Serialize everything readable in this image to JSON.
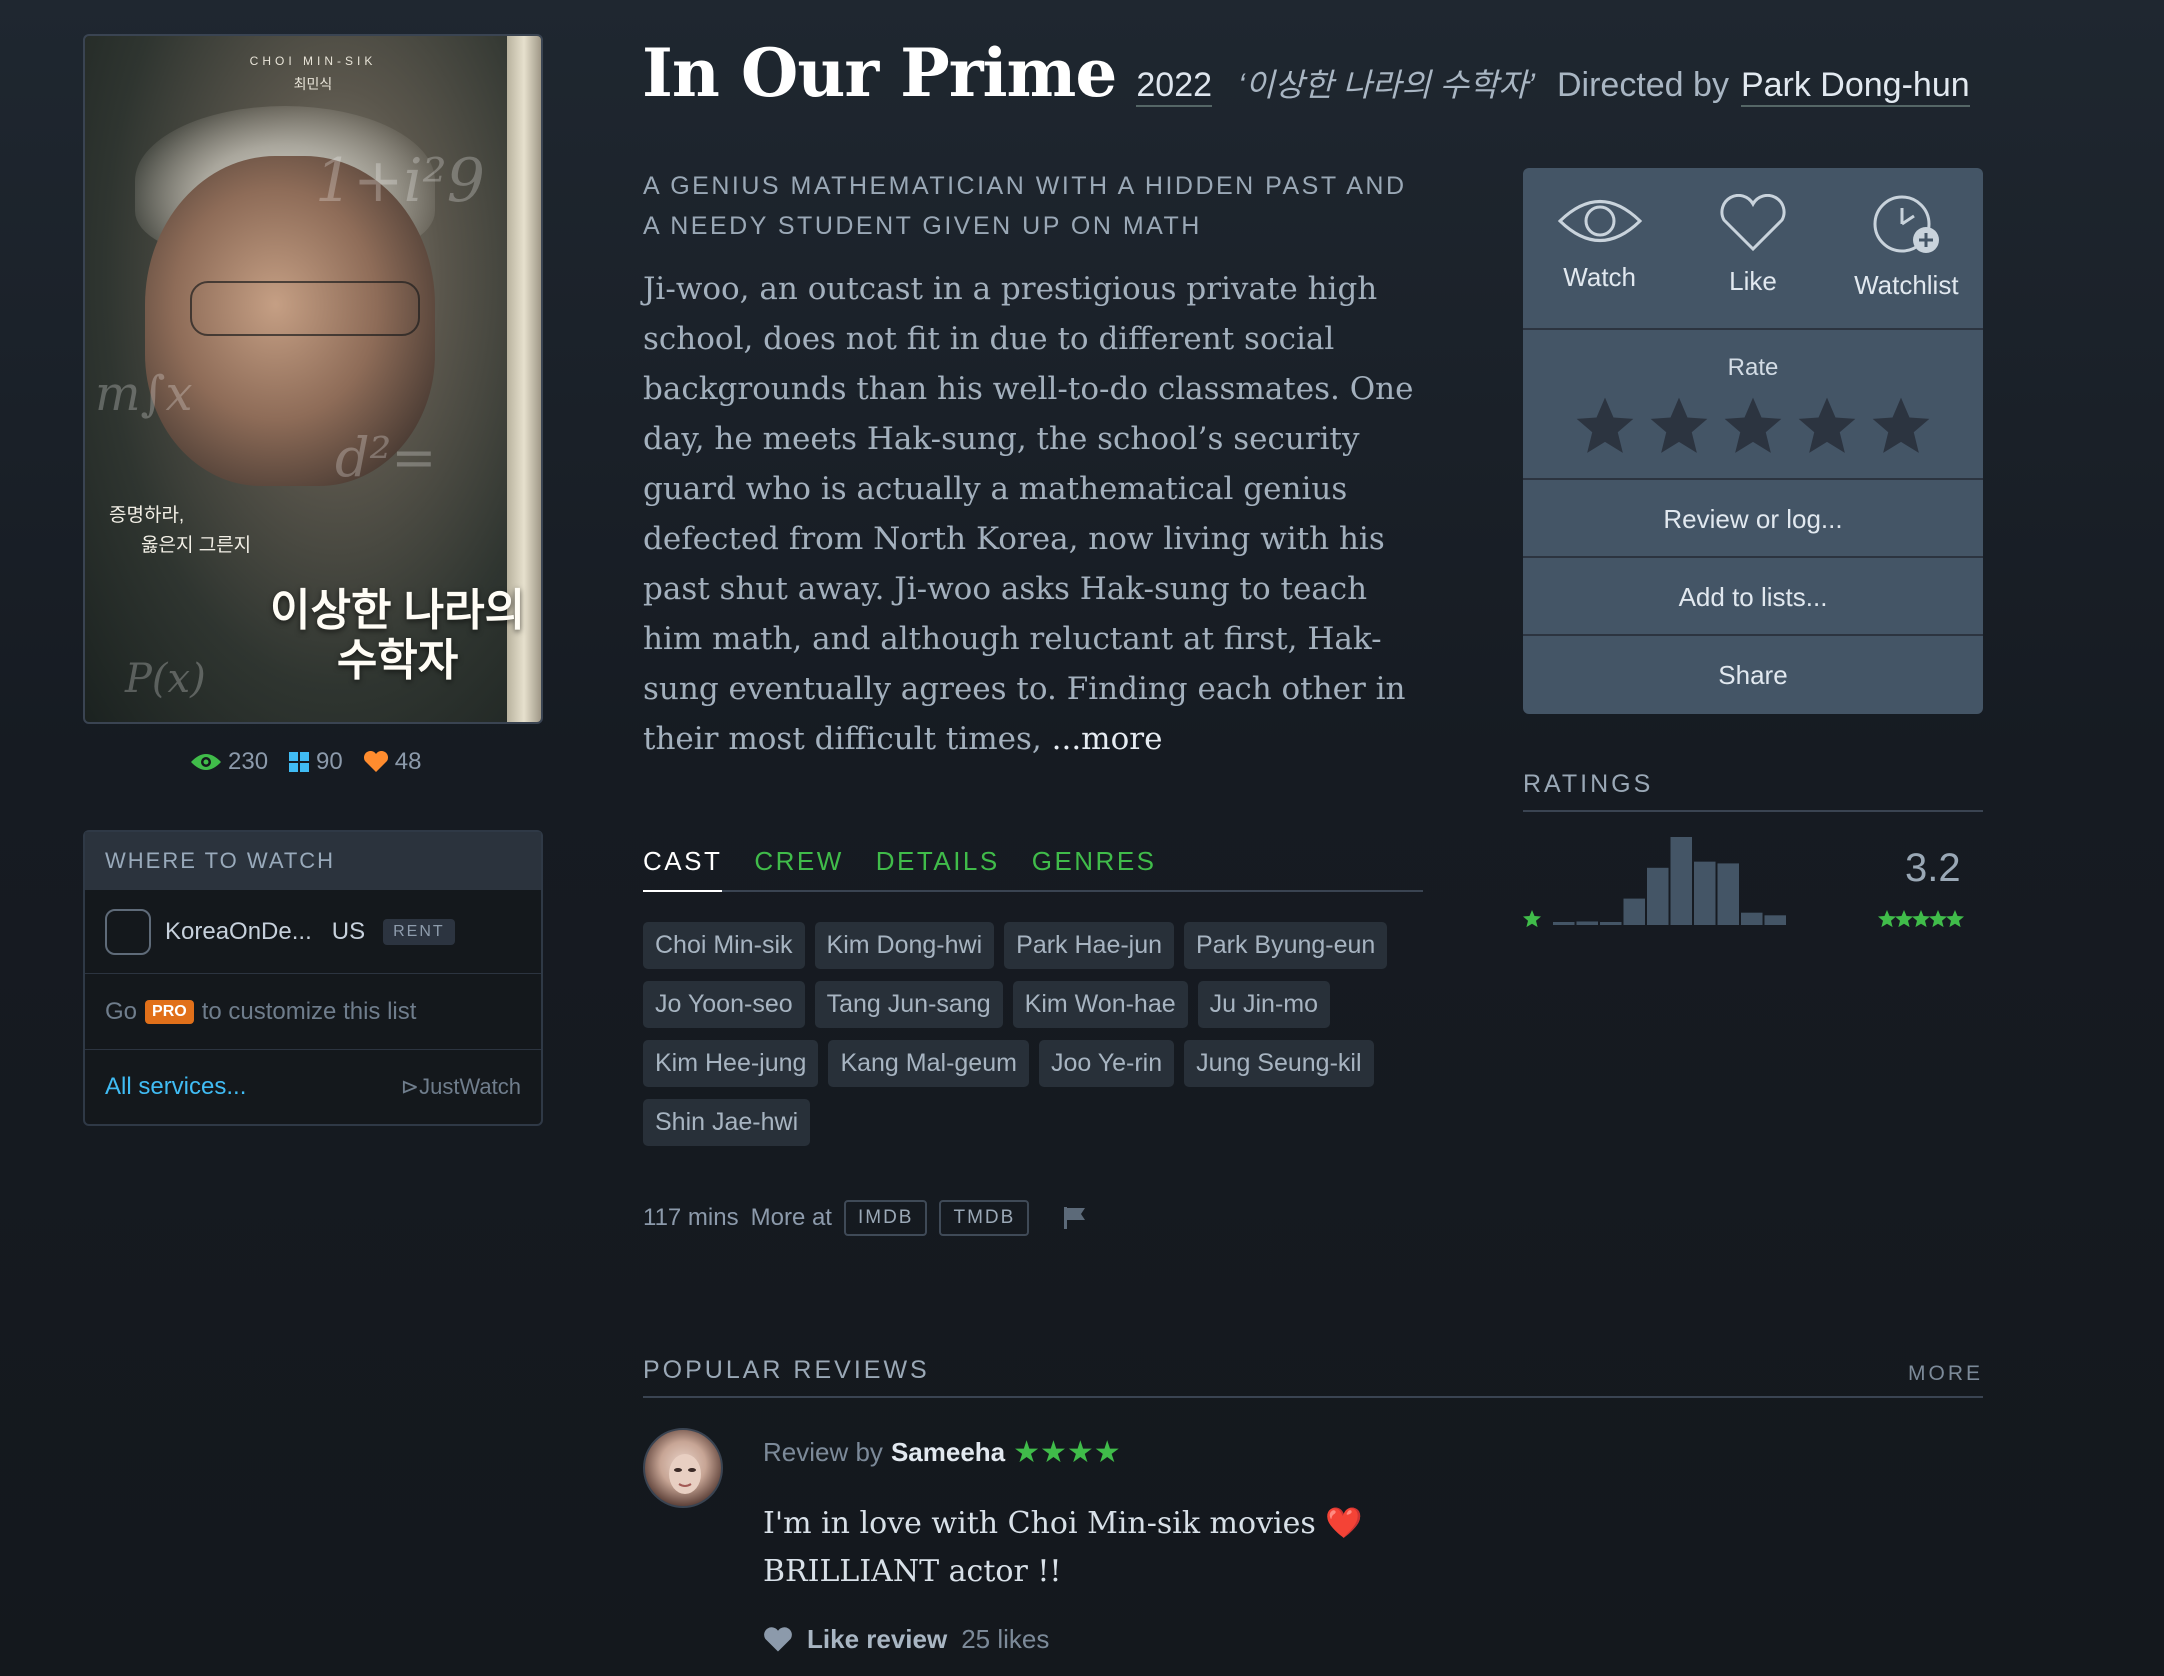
{
  "film": {
    "title": "In Our Prime",
    "year": "2022",
    "original_title": "‘이상한 나라의 수학자’",
    "directed_by": "Directed by",
    "director": "Park Dong-hun"
  },
  "poster": {
    "actor_en": "CHOI MIN-SIK",
    "actor_ko": "최민식",
    "tagline_ko_1": "증명하라,",
    "tagline_ko_2": "옳은지 그른지",
    "title_ko_1": "이상한 나라의",
    "title_ko_2": "수학자"
  },
  "stats": {
    "watched": "230",
    "lists": "90",
    "likes": "48"
  },
  "where_to_watch": {
    "header": "WHERE TO WATCH",
    "service": "KoreaOnDe...",
    "country": "US",
    "badge": "RENT",
    "pro_go": "Go",
    "pro_badge": "PRO",
    "pro_text": "to customize this list",
    "all_services": "All services...",
    "provider": "JustWatch"
  },
  "tagline": "A GENIUS MATHEMATICIAN WITH A HIDDEN PAST AND A NEEDY STUDENT GIVEN UP ON MATH",
  "synopsis": "Ji-woo, an outcast in a prestigious private high school, does not fit in due to different social backgrounds than his well-to-do classmates. One day, he meets Hak-sung, the school’s security guard who is actually a mathematical genius defected from North Korea, now living with his past shut away. Ji-woo asks Hak-sung to teach him math, and although reluctant at first, Hak-sung eventually agrees to. Finding each other in their most difficult times,",
  "synopsis_more": "...more",
  "tabs": [
    {
      "label": "CAST",
      "active": true
    },
    {
      "label": "CREW",
      "active": false
    },
    {
      "label": "DETAILS",
      "active": false
    },
    {
      "label": "GENRES",
      "active": false
    }
  ],
  "cast": [
    "Choi Min-sik",
    "Kim Dong-hwi",
    "Park Hae-jun",
    "Park Byung-eun",
    "Jo Yoon-seo",
    "Tang Jun-sang",
    "Kim Won-hae",
    "Ju Jin-mo",
    "Kim Hee-jung",
    "Kang Mal-geum",
    "Joo Ye-rin",
    "Jung Seung-kil",
    "Shin Jae-hwi"
  ],
  "meta": {
    "runtime": "117 mins",
    "more_at": "More at",
    "imdb": "IMDB",
    "tmdb": "TMDB"
  },
  "actions": {
    "watch": "Watch",
    "like": "Like",
    "watchlist": "Watchlist",
    "rate": "Rate",
    "review": "Review or log...",
    "add_lists": "Add to lists...",
    "share": "Share"
  },
  "ratings": {
    "header": "RATINGS",
    "average": "3.2",
    "histogram": [
      0.03,
      0.04,
      0.03,
      0.3,
      0.65,
      1.0,
      0.72,
      0.7,
      0.14,
      0.11
    ]
  },
  "reviews": {
    "header": "POPULAR REVIEWS",
    "more": "MORE",
    "review_by": "Review by",
    "author": "Sameeha",
    "stars": "★★★★",
    "text_1": "I'm in love with Choi Min-sik movies ❤️",
    "text_2": "BRILLIANT actor !!",
    "like_label": "Like review",
    "likes": "25 likes"
  },
  "colors": {
    "green": "#40bc4a",
    "orange": "#ff8c2e",
    "blue": "#40bcf4",
    "panel": "#445566"
  }
}
